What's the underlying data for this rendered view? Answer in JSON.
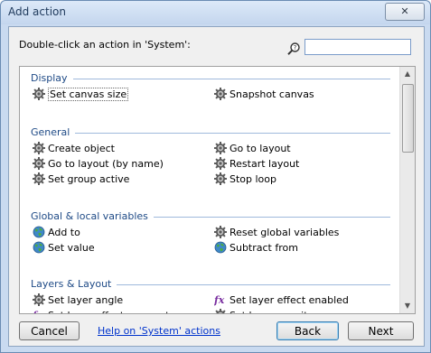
{
  "window": {
    "title": "Add action",
    "close_glyph": "✕"
  },
  "search": {
    "prompt": "Double-click an action in 'System':",
    "value": "",
    "icon": "magnifier-icon"
  },
  "groups": [
    {
      "header": "Display",
      "items": [
        {
          "label": "Set canvas size",
          "icon": "gear",
          "selected": true
        },
        {
          "label": "Snapshot canvas",
          "icon": "gear"
        }
      ]
    },
    {
      "header": "General",
      "items": [
        {
          "label": "Create object",
          "icon": "gear"
        },
        {
          "label": "Go to layout",
          "icon": "gear"
        },
        {
          "label": "Go to layout (by name)",
          "icon": "gear"
        },
        {
          "label": "Restart layout",
          "icon": "gear"
        },
        {
          "label": "Set group active",
          "icon": "gear"
        },
        {
          "label": "Stop loop",
          "icon": "gear"
        }
      ]
    },
    {
      "header": "Global & local variables",
      "items": [
        {
          "label": "Add to",
          "icon": "globe"
        },
        {
          "label": "Reset global variables",
          "icon": "gear"
        },
        {
          "label": "Set value",
          "icon": "globe"
        },
        {
          "label": "Subtract from",
          "icon": "globe"
        }
      ]
    },
    {
      "header": "Layers & Layout",
      "items": [
        {
          "label": "Set layer angle",
          "icon": "gear"
        },
        {
          "label": "Set layer effect enabled",
          "icon": "fx"
        },
        {
          "label": "Set layer effect parameter",
          "icon": "fx"
        },
        {
          "label": "Set layer opacity",
          "icon": "gear"
        }
      ]
    }
  ],
  "footer": {
    "cancel": "Cancel",
    "help_link": "Help on 'System' actions",
    "back": "Back",
    "next": "Next"
  },
  "colors": {
    "group_header": "#1e4a86",
    "link": "#0033cc",
    "accent": "#3c7fb1"
  }
}
